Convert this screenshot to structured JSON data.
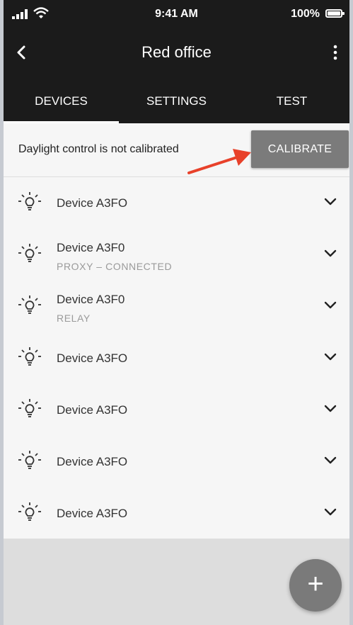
{
  "status": {
    "time": "9:41 AM",
    "battery": "100%"
  },
  "appbar": {
    "title": "Red office",
    "back_icon": "chevron-left-icon",
    "more_icon": "more-vertical-icon"
  },
  "tabs": [
    {
      "label": "DEVICES",
      "active": true
    },
    {
      "label": "SETTINGS",
      "active": false
    },
    {
      "label": "TEST",
      "active": false
    }
  ],
  "banner": {
    "message": "Daylight control is not calibrated",
    "button_label": "CALIBRATE",
    "arrow_color": "#e8412a"
  },
  "devices": [
    {
      "name": "Device A3FO",
      "sub": ""
    },
    {
      "name": "Device A3F0",
      "sub": "PROXY – CONNECTED"
    },
    {
      "name": "Device A3F0",
      "sub": "RELAY"
    },
    {
      "name": "Device A3FO",
      "sub": ""
    },
    {
      "name": "Device A3FO",
      "sub": ""
    },
    {
      "name": "Device A3FO",
      "sub": ""
    },
    {
      "name": "Device A3FO",
      "sub": ""
    }
  ],
  "fab": {
    "label": "+",
    "icon": "plus-icon"
  },
  "colors": {
    "appbar": "#1b1b1b",
    "button": "#7b7b7b",
    "background": "#f6f6f6"
  }
}
